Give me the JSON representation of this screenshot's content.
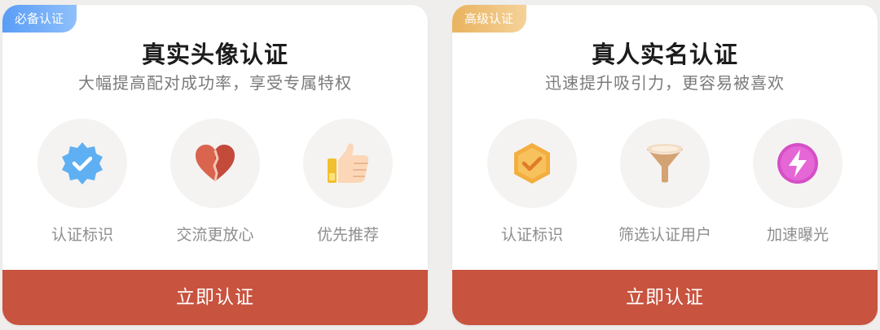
{
  "cards": [
    {
      "badge": "必备认证",
      "title": "真实头像认证",
      "subtitle": "大幅提高配对成功率，享受专属特权",
      "features": [
        {
          "label": "认证标识",
          "icon": "verified-badge-icon"
        },
        {
          "label": "交流更放心",
          "icon": "heart-icon"
        },
        {
          "label": "优先推荐",
          "icon": "thumbs-up-icon"
        }
      ],
      "button": "立即认证"
    },
    {
      "badge": "高级认证",
      "title": "真人实名认证",
      "subtitle": "迅速提升吸引力，更容易被喜欢",
      "features": [
        {
          "label": "认证标识",
          "icon": "hexagon-check-icon"
        },
        {
          "label": "筛选认证用户",
          "icon": "funnel-icon"
        },
        {
          "label": "加速曝光",
          "icon": "lightning-icon"
        }
      ],
      "button": "立即认证"
    }
  ],
  "colors": {
    "button_bg": "#c8533f",
    "badge_blue": "#5a9cf6",
    "badge_gold": "#e9b35e",
    "feature_circle": "#f5f3f2"
  }
}
